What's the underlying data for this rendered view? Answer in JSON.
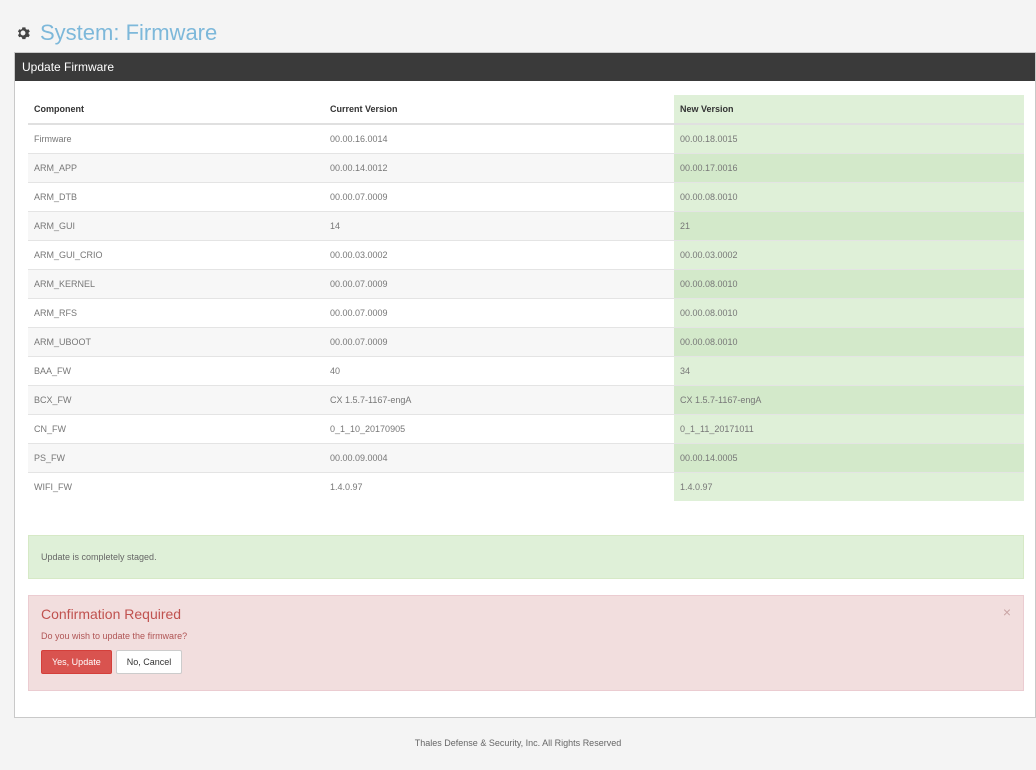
{
  "page": {
    "title": "System: Firmware",
    "title_icon": "gear-icon"
  },
  "panel": {
    "heading": "Update Firmware"
  },
  "table": {
    "headers": [
      "Component",
      "Current Version",
      "New Version"
    ],
    "rows": [
      [
        "Firmware",
        "00.00.16.0014",
        "00.00.18.0015"
      ],
      [
        "ARM_APP",
        "00.00.14.0012",
        "00.00.17.0016"
      ],
      [
        "ARM_DTB",
        "00.00.07.0009",
        "00.00.08.0010"
      ],
      [
        "ARM_GUI",
        "14",
        "21"
      ],
      [
        "ARM_GUI_CRIO",
        "00.00.03.0002",
        "00.00.03.0002"
      ],
      [
        "ARM_KERNEL",
        "00.00.07.0009",
        "00.00.08.0010"
      ],
      [
        "ARM_RFS",
        "00.00.07.0009",
        "00.00.08.0010"
      ],
      [
        "ARM_UBOOT",
        "00.00.07.0009",
        "00.00.08.0010"
      ],
      [
        "BAA_FW",
        "40",
        "34"
      ],
      [
        "BCX_FW",
        "CX 1.5.7-1167-engA",
        "CX 1.5.7-1167-engA"
      ],
      [
        "CN_FW",
        "0_1_10_20170905",
        "0_1_11_20171011"
      ],
      [
        "PS_FW",
        "00.00.09.0004",
        "00.00.14.0005"
      ],
      [
        "WIFI_FW",
        "1.4.0.97",
        "1.4.0.97"
      ]
    ]
  },
  "status": {
    "message": "Update is completely staged."
  },
  "confirm": {
    "title": "Confirmation Required",
    "question": "Do you wish to update the firmware?",
    "close_symbol": "×",
    "yes_label": "Yes, Update",
    "no_label": "No, Cancel"
  },
  "footer": {
    "text": "Thales Defense & Security, Inc. All Rights Reserved"
  },
  "colors": {
    "title": "#7db8da",
    "panel_heading_bg": "#3a3a3a",
    "new_version_bg": "#dff0d8",
    "danger": "#d9534f"
  }
}
